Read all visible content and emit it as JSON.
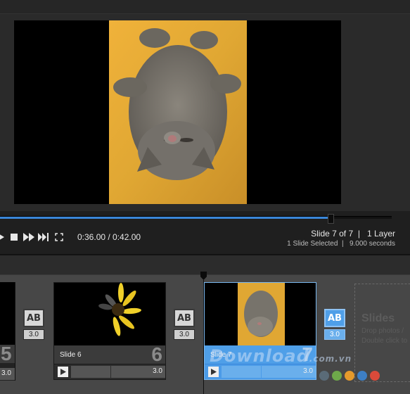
{
  "transport": {
    "time": "0:36.00 / 0:42.00",
    "progress": 0.84
  },
  "info": {
    "slide_position": "Slide 7 of 7",
    "layers": "1 Layer",
    "selection": "1 Slide Selected",
    "duration": "9.000 seconds"
  },
  "timeline": {
    "prev_slide": {
      "number": "5",
      "duration": "3.0"
    },
    "slides": [
      {
        "label": "Slide 6",
        "number": "6",
        "duration": "3.0"
      },
      {
        "label": "Slide 7",
        "number": "7",
        "duration": "3.0"
      }
    ],
    "transitions": [
      {
        "label": "AB",
        "value": "3.0"
      },
      {
        "label": "AB",
        "value": "3.0"
      },
      {
        "label": "AB",
        "value": "3.0"
      }
    ],
    "dropzone": {
      "title": "Slides",
      "line1": "Drop photos /",
      "line2": "Double click to"
    }
  },
  "watermark": {
    "text": "Download",
    "suffix": ".com.vn"
  },
  "colors": {
    "accent": "#3a86d9",
    "selected": "#4b9be8",
    "dots": [
      "#5a6b78",
      "#6ea84a",
      "#e59a2c",
      "#3d7fc5",
      "#d94a3a"
    ]
  },
  "icons": [
    "play-icon",
    "stop-icon",
    "fast-forward-icon",
    "skip-end-icon",
    "fullscreen-icon"
  ]
}
